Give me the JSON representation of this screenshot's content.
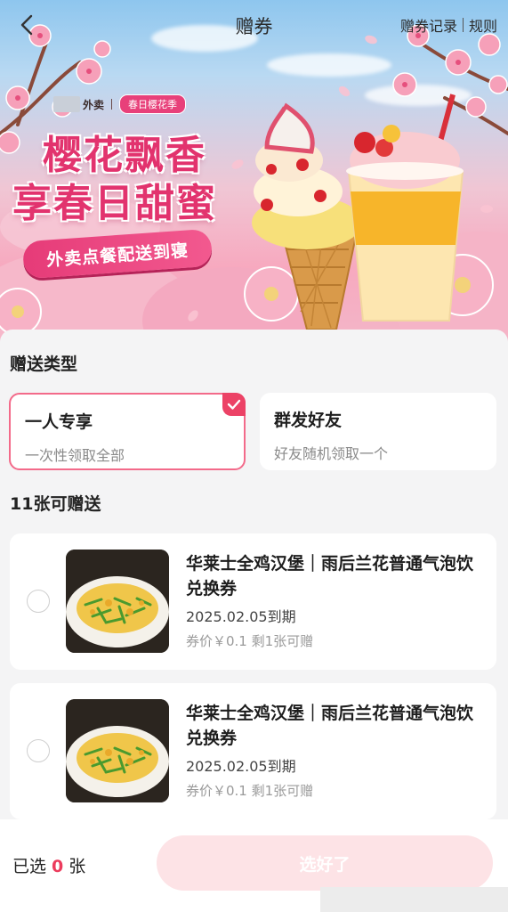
{
  "header": {
    "title": "赠券",
    "records_label": "赠券记录",
    "rules_label": "规则"
  },
  "banner": {
    "brand_name": "外卖",
    "season_tag": "春日樱花季",
    "slogan_line1": "樱花飘香",
    "slogan_line2": "享春日甜蜜",
    "ribbon_text": "外卖点餐配送到寝",
    "accent_color": "#e2336e"
  },
  "gift_type": {
    "section_title": "赠送类型",
    "options": [
      {
        "name": "一人专享",
        "desc": "一次性领取全部",
        "selected": true
      },
      {
        "name": "群发好友",
        "desc": "好友随机领取一个",
        "selected": false
      }
    ]
  },
  "coupons": {
    "section_title": "11张可赠送",
    "items": [
      {
        "title": "华莱士全鸡汉堡｜雨后兰花普通气泡饮 兑换券",
        "expiry": "2025.02.05到期",
        "meta": "券价￥0.1 剩1张可赠"
      },
      {
        "title": "华莱士全鸡汉堡｜雨后兰花普通气泡饮 兑换券",
        "expiry": "2025.02.05到期",
        "meta": "券价￥0.1 剩1张可赠"
      }
    ]
  },
  "bottom": {
    "selected_prefix": "已选",
    "selected_count": "0",
    "selected_suffix": "张",
    "confirm_label": "选好了"
  },
  "icons": [
    "chevron-left-icon",
    "check-icon"
  ],
  "colors": {
    "primary": "#ec3c5d",
    "selected_border": "#f36a8a",
    "disabled_button": "#fde3e6"
  }
}
